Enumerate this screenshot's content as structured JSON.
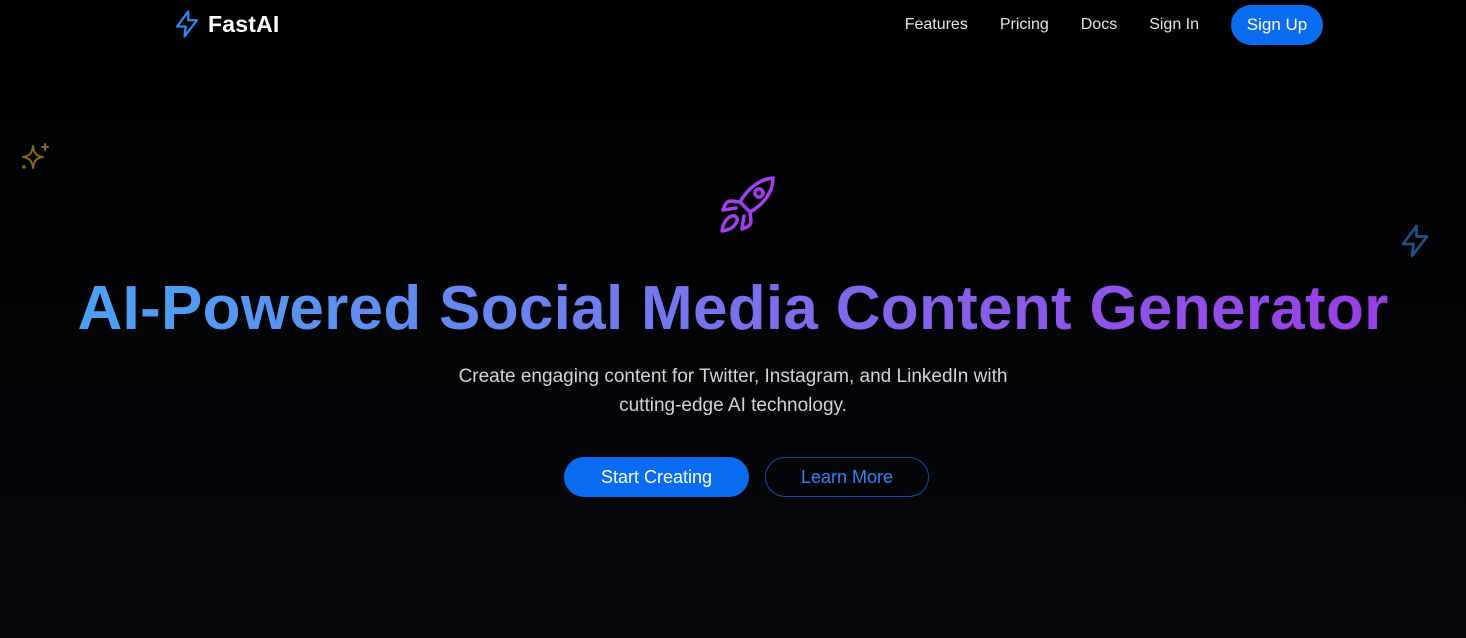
{
  "header": {
    "brand_name": "FastAI",
    "brand_icon": "lightning-bolt-icon",
    "nav": {
      "features": "Features",
      "pricing": "Pricing",
      "docs": "Docs",
      "sign_in": "Sign In"
    },
    "sign_up_label": "Sign Up"
  },
  "decorations": {
    "left_icon": "sparkles-icon",
    "right_icon": "lightning-bolt-icon",
    "hero_icon": "rocket-icon"
  },
  "hero": {
    "title": "AI-Powered Social Media Content Generator",
    "subtitle_line1": "Create engaging content for Twitter, Instagram, and LinkedIn with",
    "subtitle_line2": "cutting-edge AI technology.",
    "primary_cta": "Start Creating",
    "secondary_cta": "Learn More"
  },
  "colors": {
    "background": "#000000",
    "accent_blue": "#0a6cf0",
    "gradient_start": "#4aa3f5",
    "gradient_end": "#9b3ee6",
    "rocket_purple": "#a23ef0",
    "sparkle_gold": "#8a6a12",
    "bolt_blue": "#1f4f86"
  }
}
